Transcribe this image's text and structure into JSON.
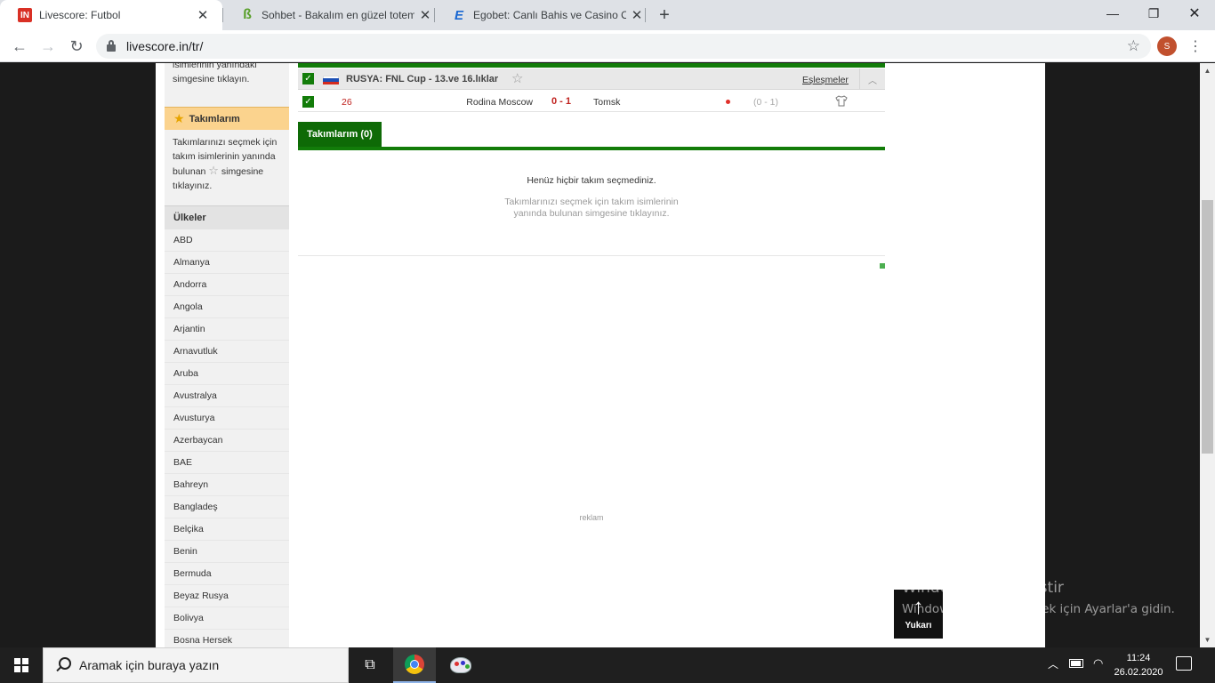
{
  "browser": {
    "tabs": [
      {
        "title": "Livescore: Futbol",
        "favicon": "livescore-icon",
        "active": true
      },
      {
        "title": "Sohbet - Bakalım en güzel totem",
        "favicon": "sohbet-icon",
        "active": false
      },
      {
        "title": "Egobet: Canlı Bahis ve Casino Oy",
        "favicon": "egobet-icon",
        "active": false
      }
    ],
    "url": "livescore.in/tr/",
    "profile_initial": "S"
  },
  "sidebar": {
    "prev_text": "isimlerinin yanındaki simgesine tıklayın.",
    "my_teams_title": "Takımlarım",
    "my_teams_text_a": "Takımlarınızı seçmek için takım isimlerinin yanında bulunan",
    "my_teams_text_b": "simgesine tıklayınız.",
    "countries_title": "Ülkeler",
    "countries": [
      "ABD",
      "Almanya",
      "Andorra",
      "Angola",
      "Arjantin",
      "Arnavutluk",
      "Aruba",
      "Avustralya",
      "Avusturya",
      "Azerbaycan",
      "BAE",
      "Bahreyn",
      "Bangladeş",
      "Belçika",
      "Benin",
      "Bermuda",
      "Beyaz Rusya",
      "Bolivya",
      "Bosna Hersek"
    ]
  },
  "league": {
    "name": "RUSYA: FNL Cup - 13.ve 16.lıklar",
    "matches_link": "Eşleşmeler"
  },
  "match": {
    "minute": "26",
    "home": "Rodina Moscow",
    "score": "0 - 1",
    "away": "Tomsk",
    "halftime": "(0 - 1)"
  },
  "my_teams": {
    "tab_label": "Takımlarım (0)",
    "empty_title": "Henüz hiçbir takım seçmediniz.",
    "empty_hint": "Takımlarınızı seçmek için takım isimlerinin yanında bulunan simgesine tıklayınız."
  },
  "ad_label": "reklam",
  "scroll_top": {
    "label": "Yukarı"
  },
  "watermark": {
    "line1": "Windows'u Etkinleştir",
    "line2": "Windows'u etkinleştirmek için Ayarlar'a gidin."
  },
  "taskbar": {
    "search_placeholder": "Aramak için buraya yazın",
    "time": "11:24",
    "date": "26.02.2020"
  },
  "colors": {
    "accent_green": "#127c09",
    "live_red": "#c0221f",
    "my_teams_header": "#fbd38e"
  }
}
